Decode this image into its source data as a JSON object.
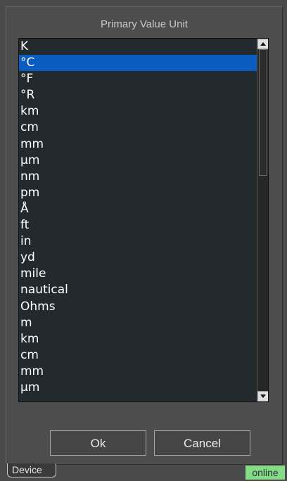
{
  "dialog": {
    "title": "Primary Value Unit",
    "selected_index": 1,
    "items": [
      "K",
      "°C",
      "°F",
      "°R",
      "km",
      "cm",
      "mm",
      "µm",
      "nm",
      "pm",
      "Å",
      "ft",
      "in",
      "yd",
      "mile",
      "nautical",
      "Ohms",
      "m",
      "km",
      "cm",
      "mm",
      "µm"
    ],
    "ok_label": "Ok",
    "cancel_label": "Cancel"
  },
  "footer": {
    "tab_label": "Device",
    "status_label": "online"
  },
  "colors": {
    "selection": "#0b5cc0",
    "status": "#86dc86"
  }
}
